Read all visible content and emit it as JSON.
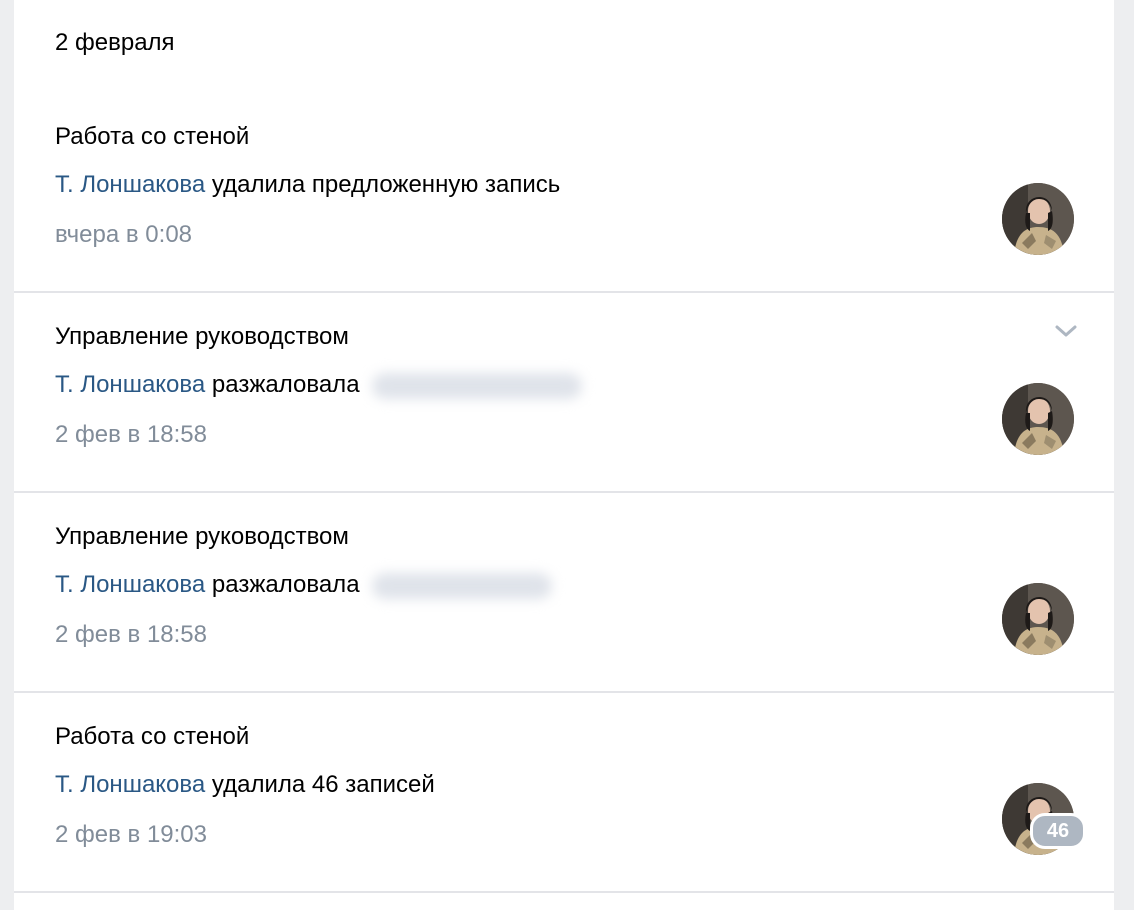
{
  "date_header": "2 февраля",
  "entries": [
    {
      "title": "Работа со стеной",
      "author": "Т. Лоншакова",
      "action": " удалила предложенную запись",
      "time": "вчера в 0:08"
    },
    {
      "title": "Управление руководством",
      "author": "Т. Лоншакова",
      "action": " разжаловала ",
      "time": "2 фев в 18:58"
    },
    {
      "title": "Управление руководством",
      "author": "Т. Лоншакова",
      "action": " разжаловала ",
      "time": "2 фев в 18:58"
    },
    {
      "title": "Работа со стеной",
      "author": "Т. Лоншакова",
      "action": " удалила 46 записей",
      "time": "2 фев в 19:03",
      "badge": "46"
    }
  ],
  "icons": {
    "expand": "chevron-down-icon"
  },
  "colors": {
    "link": "#2a5885",
    "secondary_text": "#818c99",
    "badge": "#aeb7c2"
  }
}
